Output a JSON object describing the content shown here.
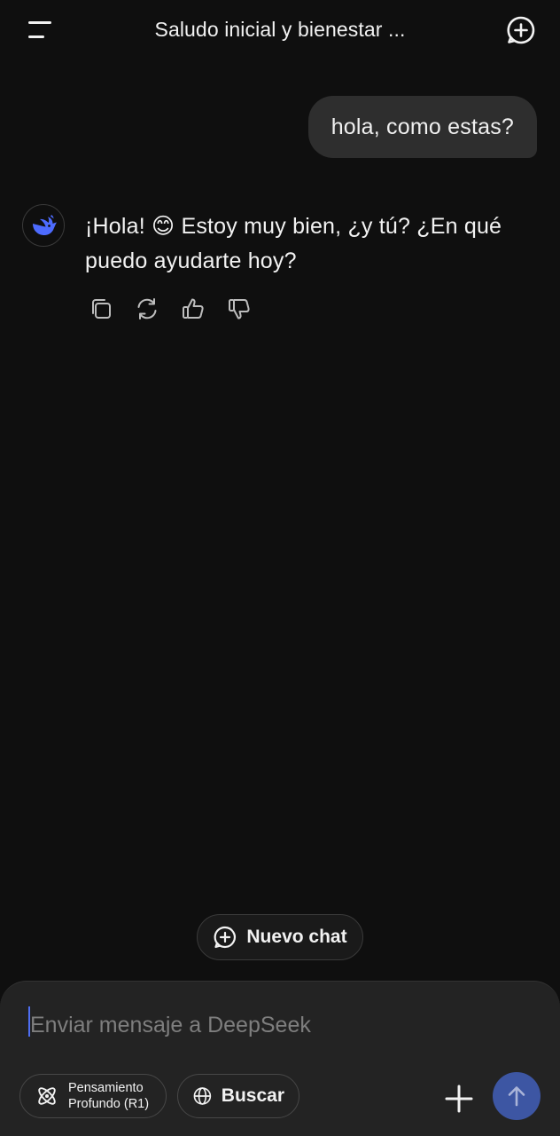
{
  "header": {
    "title": "Saludo inicial y bienestar ...",
    "menu_icon": "menu-icon",
    "new_chat_icon": "plus-circle-icon"
  },
  "messages": {
    "user": "hola, como estas?",
    "assistant": "¡Hola! 😊 Estoy muy bien, ¿y tú? ¿En qué puedo ayudarte hoy?",
    "assistant_avatar_icon": "deepseek-whale-icon"
  },
  "message_actions": [
    "copy-icon",
    "regenerate-icon",
    "thumbs-up-icon",
    "thumbs-down-icon"
  ],
  "new_chat_button": {
    "label": "Nuevo chat"
  },
  "composer": {
    "placeholder": "Enviar mensaje a DeepSeek",
    "deep_think_label": "Pensamiento\nProfundo (R1)",
    "search_label": "Buscar",
    "send_icon": "arrow-up-icon",
    "attach_icon": "plus-icon"
  },
  "colors": {
    "background": "#0f0f0f",
    "bubble": "#2e2e2e",
    "composer": "#232323",
    "accent": "#4d6bfe",
    "send_button": "#3d56a3"
  }
}
